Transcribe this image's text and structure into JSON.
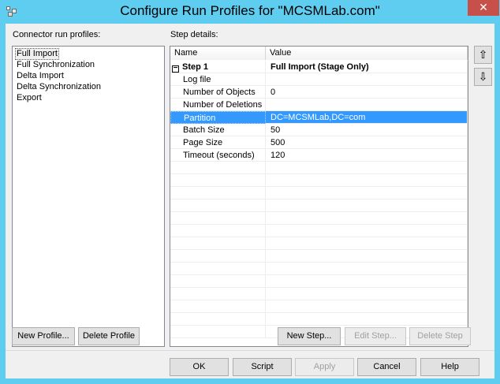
{
  "window": {
    "title": "Configure Run Profiles for \"MCSMLab.com\"",
    "close_glyph": "✕"
  },
  "profiles": {
    "label": "Connector run profiles:",
    "items": [
      {
        "label": "Full Import",
        "selected": true
      },
      {
        "label": "Full Synchronization",
        "selected": false
      },
      {
        "label": "Delta Import",
        "selected": false
      },
      {
        "label": "Delta Synchronization",
        "selected": false
      },
      {
        "label": "Export",
        "selected": false
      }
    ],
    "new_profile_label": "New Profile...",
    "delete_profile_label": "Delete Profile"
  },
  "step_details": {
    "label": "Step details:",
    "columns": [
      "Name",
      "Value"
    ],
    "expander_glyph": "−",
    "rows": [
      {
        "name": "Step 1",
        "value": "Full Import (Stage Only)",
        "header": true
      },
      {
        "name": "Log file",
        "value": ""
      },
      {
        "name": "Number of Objects",
        "value": "0"
      },
      {
        "name": "Number of Deletions",
        "value": ""
      },
      {
        "name": "Partition",
        "value": "DC=MCSMLab,DC=com",
        "selected": true
      },
      {
        "name": "Batch Size",
        "value": "50"
      },
      {
        "name": "Page Size",
        "value": "500"
      },
      {
        "name": "Timeout (seconds)",
        "value": "120"
      }
    ],
    "move_up_glyph": "⇧",
    "move_down_glyph": "⇩",
    "new_step_label": "New Step...",
    "edit_step_label": "Edit Step...",
    "delete_step_label": "Delete Step"
  },
  "footer": {
    "ok_label": "OK",
    "script_label": "Script",
    "apply_label": "Apply",
    "cancel_label": "Cancel",
    "help_label": "Help"
  }
}
